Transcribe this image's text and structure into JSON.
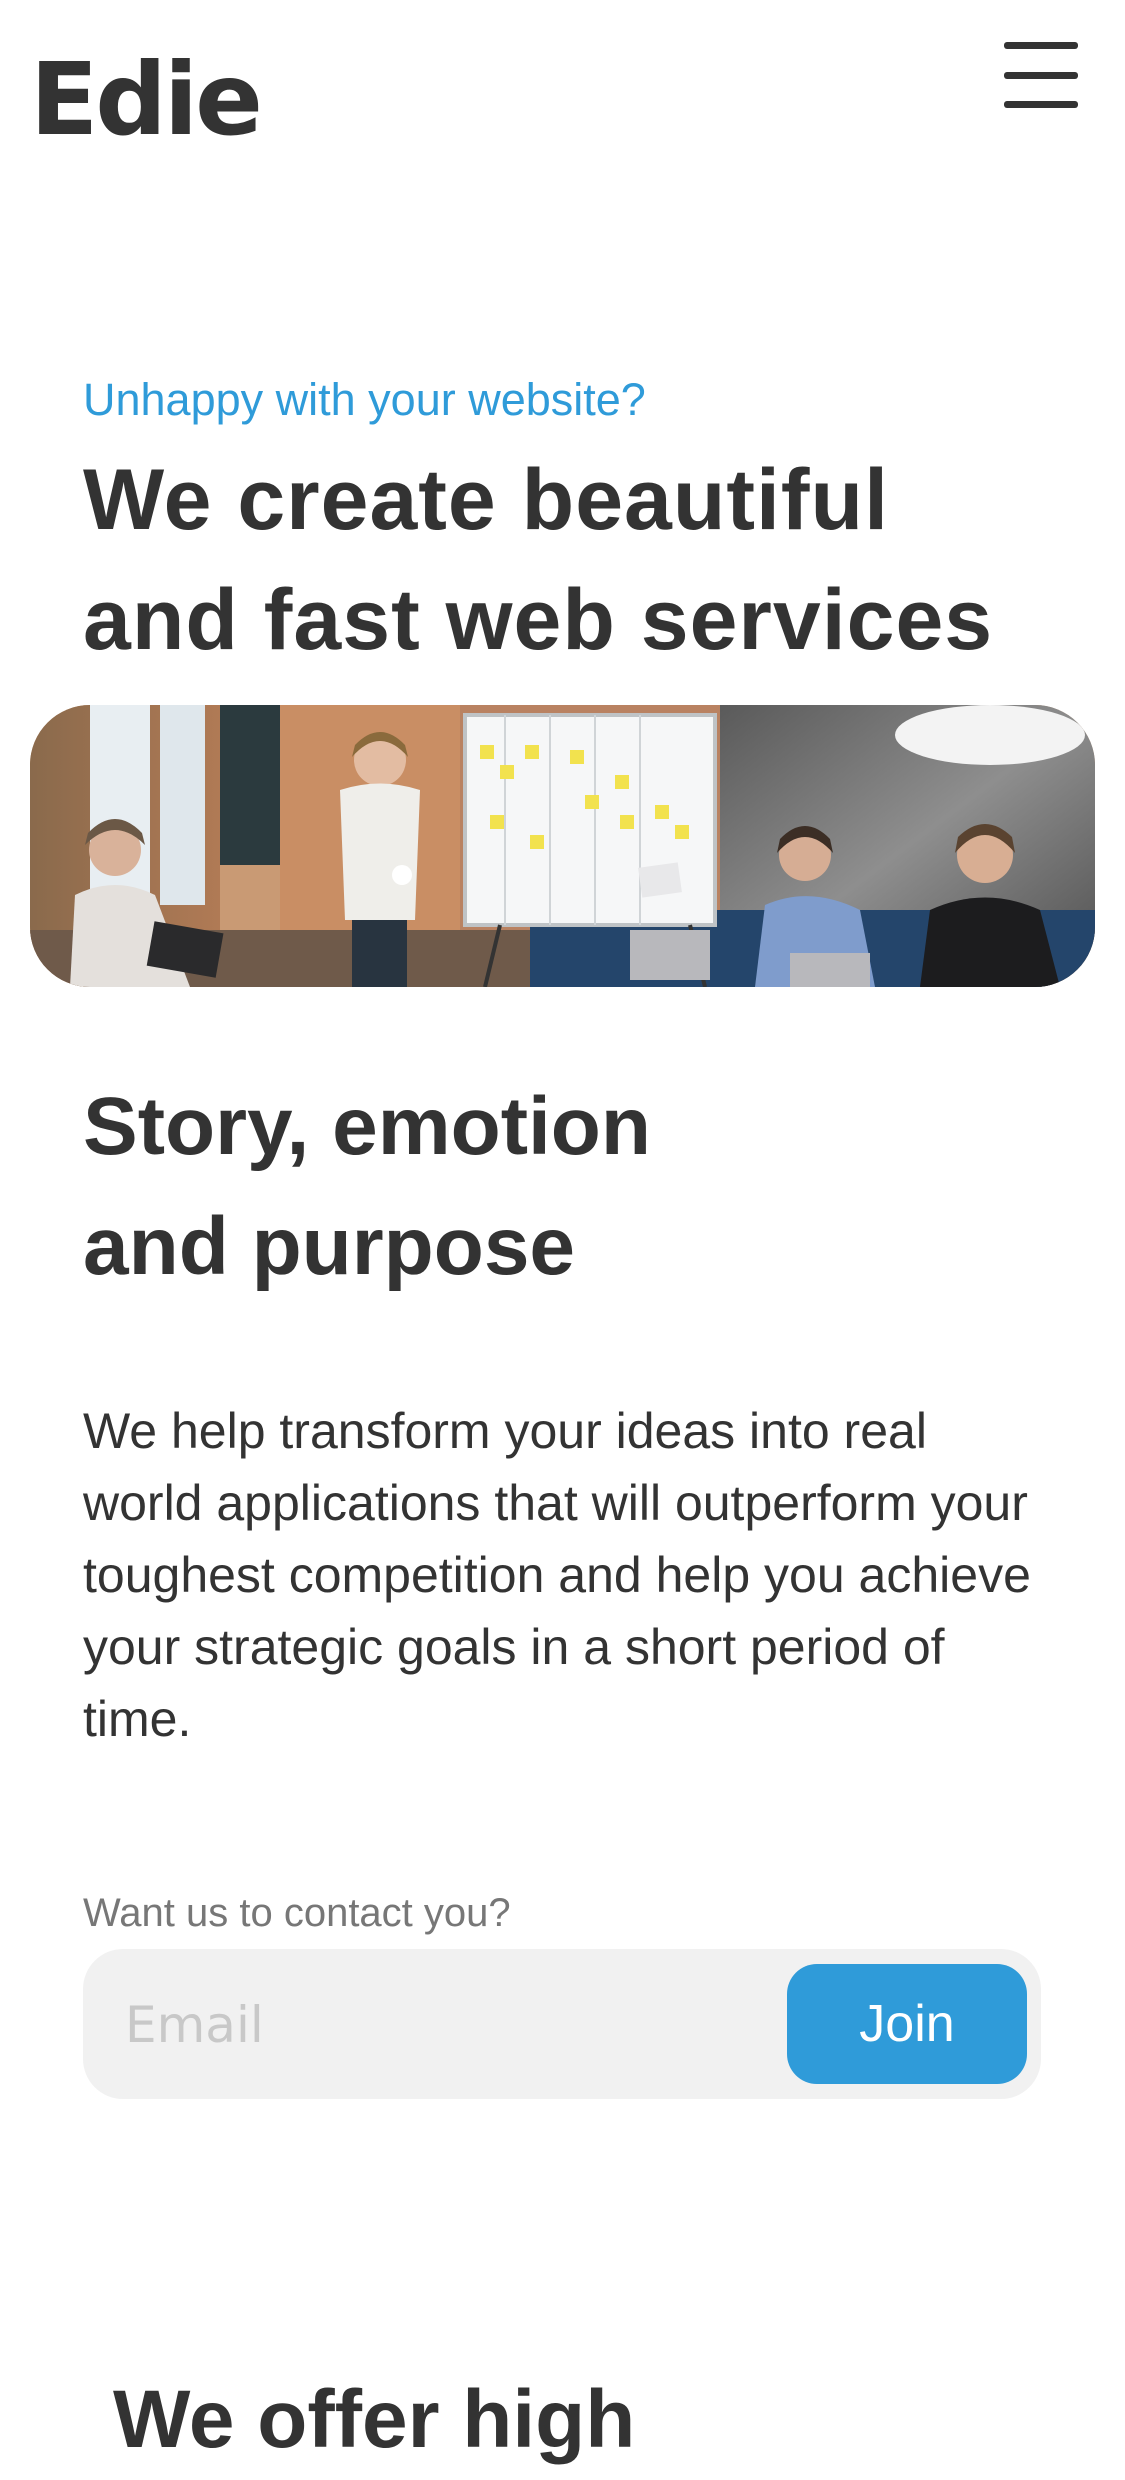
{
  "header": {
    "logo": "Edie",
    "menu_icon": "hamburger-menu-icon"
  },
  "hero": {
    "eyebrow": "Unhappy with your website?",
    "title_line1": "We create beautiful",
    "title_line2": "and fast web services",
    "image_alt": "team-meeting-photo"
  },
  "story": {
    "title_line1": "Story, emotion",
    "title_line2": "and purpose",
    "body": "We help transform your ideas into real world applications that will outperform your toughest competition and help you achieve your strategic goals in a short period of time."
  },
  "contact": {
    "label": "Want us to contact you?",
    "email_placeholder": "Email",
    "join_label": "Join"
  },
  "offer": {
    "title_partial": "We offer high"
  },
  "colors": {
    "accent": "#2f9bd9",
    "text": "#333333",
    "muted": "#777777",
    "input_bg": "#f1f1f1"
  }
}
